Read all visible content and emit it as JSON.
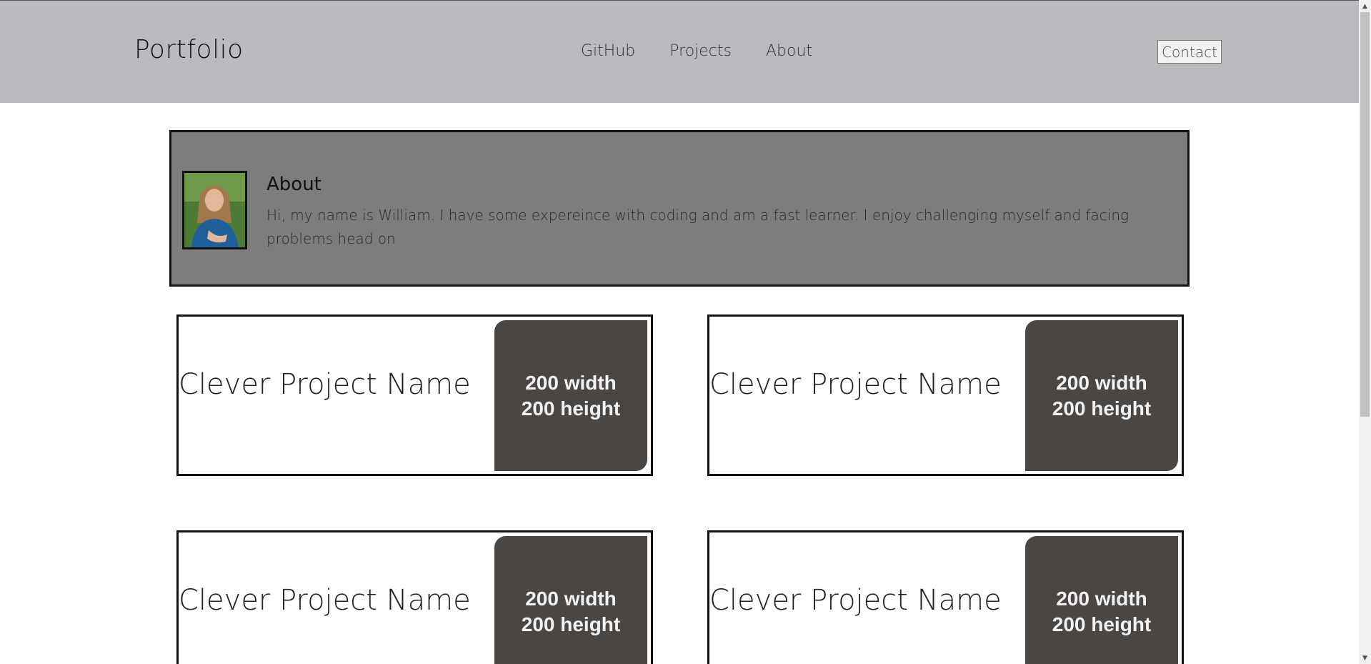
{
  "header": {
    "brand": "Portfolio",
    "nav": [
      "GitHub",
      "Projects",
      "About"
    ],
    "contact_label": "Contact"
  },
  "about": {
    "title": "About",
    "text": "Hi, my name is William. I have some expereince with coding and am a fast learner. I enjoy challenging myself and facing problems head on"
  },
  "projects": [
    {
      "name": "Clever Project Name",
      "thumb_line1": "200 width",
      "thumb_line2": "200 height"
    },
    {
      "name": "Clever Project Name",
      "thumb_line1": "200 width",
      "thumb_line2": "200 height"
    },
    {
      "name": "Clever Project Name",
      "thumb_line1": "200 width",
      "thumb_line2": "200 height"
    },
    {
      "name": "Clever Project Name",
      "thumb_line1": "200 width",
      "thumb_line2": "200 height"
    }
  ],
  "colors": {
    "header_bg": "#bbbac0",
    "about_bg": "#7d7d7d",
    "thumb_bg": "#4a4644"
  }
}
